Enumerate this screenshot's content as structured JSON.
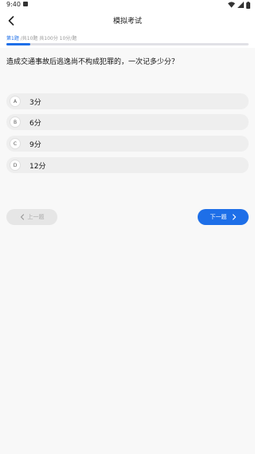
{
  "status_bar": {
    "time": "9:40",
    "icons": [
      "notification-icon",
      "wifi-icon",
      "signal-icon",
      "battery-icon"
    ]
  },
  "header": {
    "title": "模拟考试",
    "back_icon": "chevron-left-icon"
  },
  "progress": {
    "current": "第1题",
    "info": " /共10题  共100分  10分/题",
    "fraction": 0.1,
    "color": "#1e6fe8"
  },
  "question": {
    "text": "造成交通事故后逃逸尚不构成犯罪的，一次记多少分？",
    "options": [
      {
        "letter": "A",
        "text": "3分"
      },
      {
        "letter": "B",
        "text": "6分"
      },
      {
        "letter": "C",
        "text": "9分"
      },
      {
        "letter": "D",
        "text": "12分"
      }
    ]
  },
  "nav": {
    "prev_label": "上一题",
    "next_label": "下一题",
    "accent": "#1e6fe8"
  }
}
